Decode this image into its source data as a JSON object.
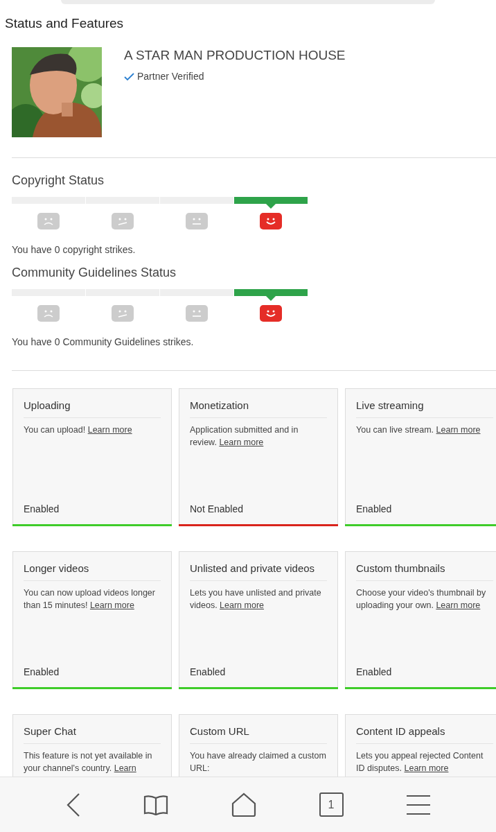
{
  "page_title": "Status and Features",
  "channel": {
    "name": "A STAR MAN PRODUCTION HOUSE",
    "badge": "Partner Verified"
  },
  "statuses": [
    {
      "title": "Copyright Status",
      "segments": [
        {
          "kind": "sad",
          "selected": false
        },
        {
          "kind": "skeptical",
          "selected": false
        },
        {
          "kind": "neutral",
          "selected": false
        },
        {
          "kind": "happy",
          "selected": true
        }
      ],
      "message": "You have 0 copyright strikes."
    },
    {
      "title": "Community Guidelines Status",
      "segments": [
        {
          "kind": "sad",
          "selected": false
        },
        {
          "kind": "skeptical",
          "selected": false
        },
        {
          "kind": "neutral",
          "selected": false
        },
        {
          "kind": "happy",
          "selected": true
        }
      ],
      "message": "You have 0 Community Guidelines strikes."
    }
  ],
  "features": [
    {
      "title": "Uploading",
      "description": "You can upload!",
      "link": "Learn more",
      "status": "Enabled",
      "enabled": true
    },
    {
      "title": "Monetization",
      "description": "Application submitted and in review.",
      "link": "Learn more",
      "status": "Not Enabled",
      "enabled": false
    },
    {
      "title": "Live streaming",
      "description": "You can live stream.",
      "link": "Learn more",
      "status": "Enabled",
      "enabled": true
    },
    {
      "title": "Longer videos",
      "description": "You can now upload videos longer than 15 minutes!",
      "link": "Learn more",
      "status": "Enabled",
      "enabled": true
    },
    {
      "title": "Unlisted and private videos",
      "description": "Lets you have unlisted and private videos.",
      "link": "Learn more",
      "status": "Enabled",
      "enabled": true
    },
    {
      "title": "Custom thumbnails",
      "description": "Choose your video's thumbnail by uploading your own.",
      "link": "Learn more",
      "status": "Enabled",
      "enabled": true
    },
    {
      "title": "Super Chat",
      "description": "This feature is not yet available in your channel's country.",
      "link": "Learn"
    },
    {
      "title": "Custom URL",
      "description": "You have already claimed a custom URL:"
    },
    {
      "title": "Content ID appeals",
      "description": "Lets you appeal rejected Content ID disputes.",
      "link": "Learn more"
    }
  ],
  "bottom_nav": {
    "tab_count": "1"
  }
}
